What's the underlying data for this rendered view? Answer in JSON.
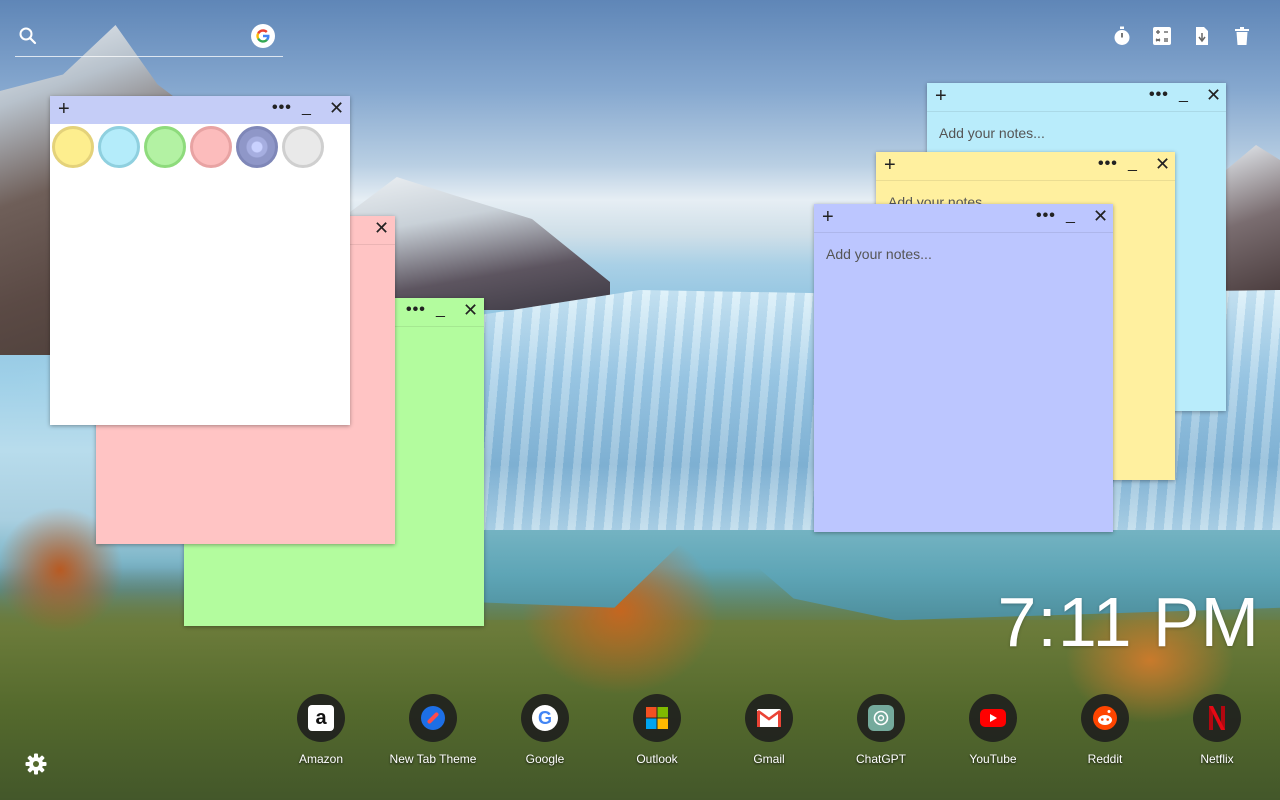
{
  "search": {
    "placeholder": "",
    "engine_icon": "google-g-icon"
  },
  "top_tools": [
    {
      "name": "timer-icon"
    },
    {
      "name": "calculator-icon"
    },
    {
      "name": "clipboard-icon"
    },
    {
      "name": "trash-icon"
    }
  ],
  "notes": {
    "placeholder": "Add your notes...",
    "colors": {
      "white": "#ffffff",
      "pink": "#ffc4c4",
      "green": "#b3fc9e",
      "blue": "#bcc6ff",
      "cyan": "#b9ecfb",
      "yellow": "#fff09f"
    },
    "swatch_colors": [
      "#fdee8e",
      "#b4ecfa",
      "#b3f2a3",
      "#fcbcbc",
      "#8f97c8",
      "#e9e9e9"
    ]
  },
  "clock": {
    "time": "7:11 PM"
  },
  "shortcuts": [
    {
      "label": "Amazon",
      "icon": "amazon-icon"
    },
    {
      "label": "New Tab Theme",
      "icon": "new-tab-theme-icon"
    },
    {
      "label": "Google",
      "icon": "google-icon"
    },
    {
      "label": "Outlook",
      "icon": "outlook-icon"
    },
    {
      "label": "Gmail",
      "icon": "gmail-icon"
    },
    {
      "label": "ChatGPT",
      "icon": "chatgpt-icon"
    },
    {
      "label": "YouTube",
      "icon": "youtube-icon"
    },
    {
      "label": "Reddit",
      "icon": "reddit-icon"
    },
    {
      "label": "Netflix",
      "icon": "netflix-icon"
    }
  ]
}
